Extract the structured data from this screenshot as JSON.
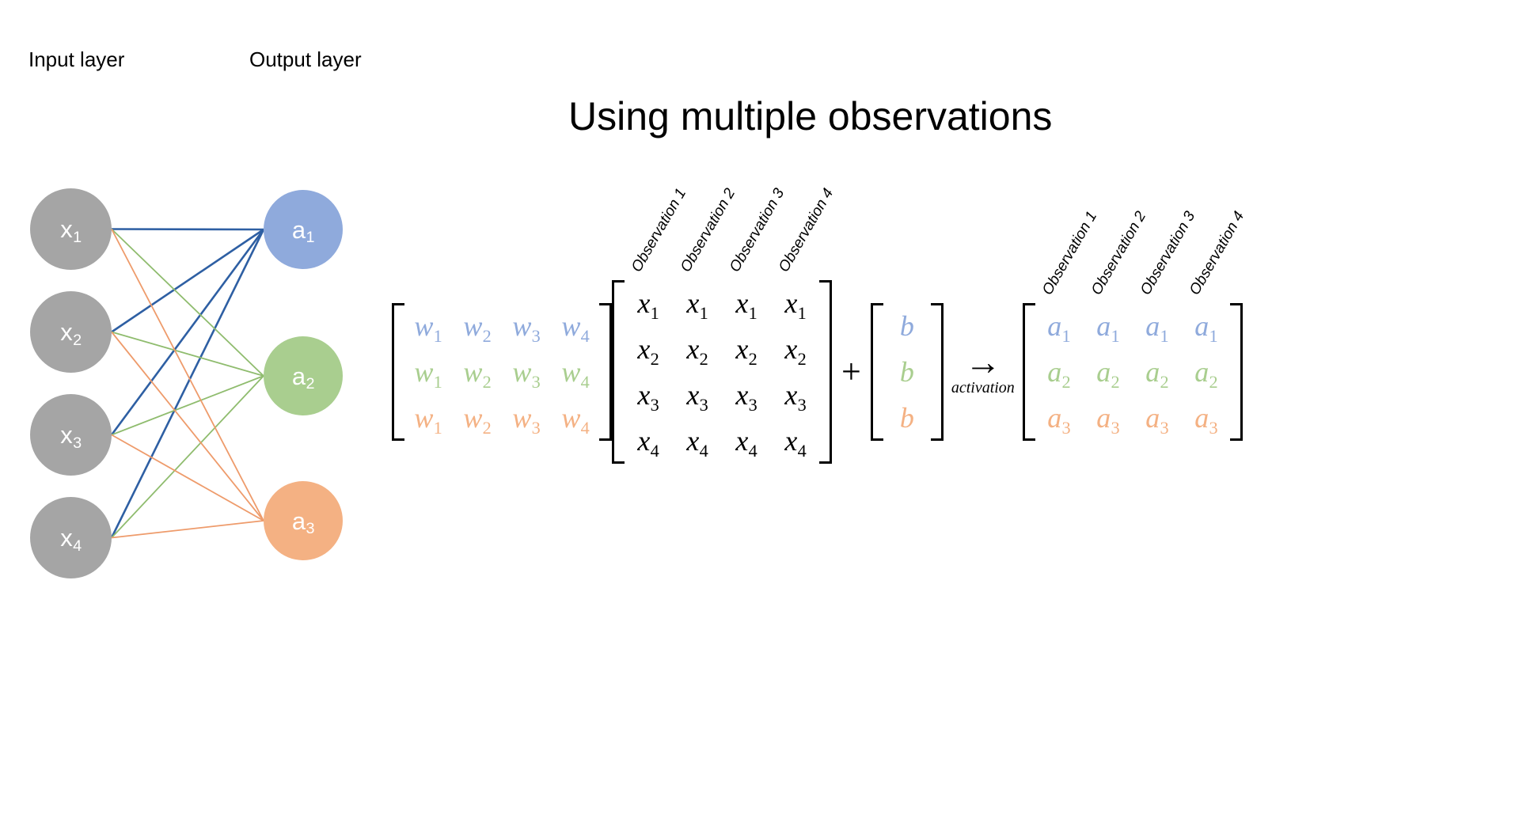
{
  "title": "Using multiple observations",
  "labels": {
    "input_layer": "Input layer",
    "output_layer": "Output layer"
  },
  "colors": {
    "input_node": "#A5A5A5",
    "blue": "#8FAADC",
    "green": "#A9CE8F",
    "orange": "#F4B183",
    "edge_blue": "#2E5FA3",
    "edge_green": "#8FBC6E",
    "edge_orange": "#EE9B6B",
    "text_on_node": "#FFFFFF",
    "black": "#000000"
  },
  "network": {
    "input_nodes": [
      {
        "base": "x",
        "sub": "1"
      },
      {
        "base": "x",
        "sub": "2"
      },
      {
        "base": "x",
        "sub": "3"
      },
      {
        "base": "x",
        "sub": "4"
      }
    ],
    "output_nodes": [
      {
        "base": "a",
        "sub": "1",
        "color": "#8FAADC"
      },
      {
        "base": "a",
        "sub": "2",
        "color": "#A9CE8F"
      },
      {
        "base": "a",
        "sub": "3",
        "color": "#F4B183"
      }
    ]
  },
  "equation": {
    "weight_matrix": {
      "name": "weight-matrix",
      "rows": [
        {
          "color": "#8FAADC",
          "cells": [
            {
              "base": "w",
              "sub": "1"
            },
            {
              "base": "w",
              "sub": "2"
            },
            {
              "base": "w",
              "sub": "3"
            },
            {
              "base": "w",
              "sub": "4"
            }
          ]
        },
        {
          "color": "#A9CE8F",
          "cells": [
            {
              "base": "w",
              "sub": "1"
            },
            {
              "base": "w",
              "sub": "2"
            },
            {
              "base": "w",
              "sub": "3"
            },
            {
              "base": "w",
              "sub": "4"
            }
          ]
        },
        {
          "color": "#F4B183",
          "cells": [
            {
              "base": "w",
              "sub": "1"
            },
            {
              "base": "w",
              "sub": "2"
            },
            {
              "base": "w",
              "sub": "3"
            },
            {
              "base": "w",
              "sub": "4"
            }
          ]
        }
      ]
    },
    "input_matrix": {
      "name": "input-matrix",
      "headers": [
        "Observation 1",
        "Observation 2",
        "Observation 3",
        "Observation 4"
      ],
      "rows": [
        {
          "color": "#000000",
          "cells": [
            {
              "base": "x",
              "sub": "1"
            },
            {
              "base": "x",
              "sub": "1"
            },
            {
              "base": "x",
              "sub": "1"
            },
            {
              "base": "x",
              "sub": "1"
            }
          ]
        },
        {
          "color": "#000000",
          "cells": [
            {
              "base": "x",
              "sub": "2"
            },
            {
              "base": "x",
              "sub": "2"
            },
            {
              "base": "x",
              "sub": "2"
            },
            {
              "base": "x",
              "sub": "2"
            }
          ]
        },
        {
          "color": "#000000",
          "cells": [
            {
              "base": "x",
              "sub": "3"
            },
            {
              "base": "x",
              "sub": "3"
            },
            {
              "base": "x",
              "sub": "3"
            },
            {
              "base": "x",
              "sub": "3"
            }
          ]
        },
        {
          "color": "#000000",
          "cells": [
            {
              "base": "x",
              "sub": "4"
            },
            {
              "base": "x",
              "sub": "4"
            },
            {
              "base": "x",
              "sub": "4"
            },
            {
              "base": "x",
              "sub": "4"
            }
          ]
        }
      ]
    },
    "plus_operator": "+",
    "bias_vector": {
      "name": "bias-vector",
      "rows": [
        {
          "color": "#8FAADC",
          "cells": [
            {
              "base": "b",
              "sub": ""
            }
          ]
        },
        {
          "color": "#A9CE8F",
          "cells": [
            {
              "base": "b",
              "sub": ""
            }
          ]
        },
        {
          "color": "#F4B183",
          "cells": [
            {
              "base": "b",
              "sub": ""
            }
          ]
        }
      ]
    },
    "activation_arrow": "→",
    "activation_label": "activation",
    "output_matrix": {
      "name": "output-matrix",
      "headers": [
        "Observation 1",
        "Observation 2",
        "Observation 3",
        "Observation 4"
      ],
      "rows": [
        {
          "color": "#8FAADC",
          "cells": [
            {
              "base": "a",
              "sub": "1"
            },
            {
              "base": "a",
              "sub": "1"
            },
            {
              "base": "a",
              "sub": "1"
            },
            {
              "base": "a",
              "sub": "1"
            }
          ]
        },
        {
          "color": "#A9CE8F",
          "cells": [
            {
              "base": "a",
              "sub": "2"
            },
            {
              "base": "a",
              "sub": "2"
            },
            {
              "base": "a",
              "sub": "2"
            },
            {
              "base": "a",
              "sub": "2"
            }
          ]
        },
        {
          "color": "#F4B183",
          "cells": [
            {
              "base": "a",
              "sub": "3"
            },
            {
              "base": "a",
              "sub": "3"
            },
            {
              "base": "a",
              "sub": "3"
            },
            {
              "base": "a",
              "sub": "3"
            }
          ]
        }
      ]
    }
  }
}
